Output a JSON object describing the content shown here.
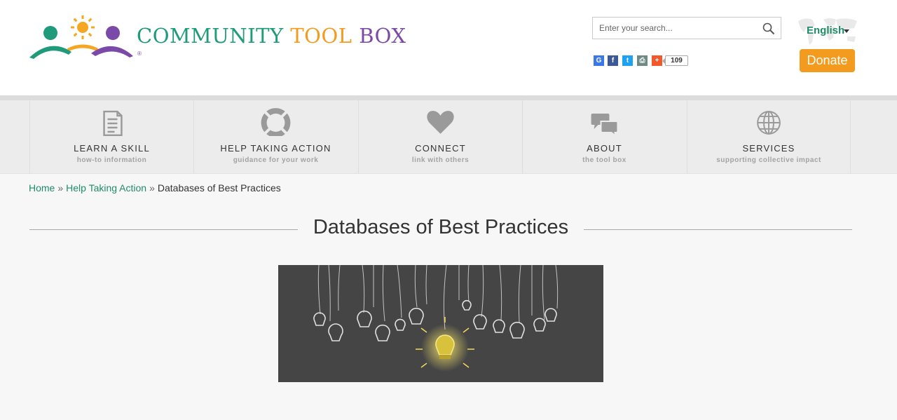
{
  "brand": {
    "word1": "COMMUNITY",
    "word2": "TOOL",
    "word3": "BOX",
    "registered": "®",
    "colors": {
      "teal": "#1f9a7a",
      "orange": "#f39b1e",
      "purple": "#7b4aa8",
      "sun": "#f5a623"
    }
  },
  "search": {
    "placeholder": "Enter your search..."
  },
  "language": {
    "label": "English"
  },
  "donate": {
    "label": "Donate",
    "color": "#f39b1e"
  },
  "share": {
    "buttons": [
      {
        "name": "google",
        "glyph": "G",
        "color": "#3b78e7"
      },
      {
        "name": "facebook",
        "glyph": "f",
        "color": "#3b5998"
      },
      {
        "name": "twitter",
        "glyph": "t",
        "color": "#1da1f2"
      },
      {
        "name": "print",
        "glyph": "⎙",
        "color": "#6d8a85"
      },
      {
        "name": "more",
        "glyph": "+",
        "color": "#f1582c"
      }
    ],
    "count": "109"
  },
  "nav": [
    {
      "title": "LEARN A SKILL",
      "subtitle": "how-to information",
      "icon": "document-icon"
    },
    {
      "title": "HELP TAKING ACTION",
      "subtitle": "guidance for your work",
      "icon": "lifebuoy-icon"
    },
    {
      "title": "CONNECT",
      "subtitle": "link with others",
      "icon": "heart-icon"
    },
    {
      "title": "ABOUT",
      "subtitle": "the tool box",
      "icon": "chat-icon"
    },
    {
      "title": "SERVICES",
      "subtitle": "supporting collective impact",
      "icon": "globe-icon"
    }
  ],
  "breadcrumb": {
    "home": "Home",
    "separator": "»",
    "section": "Help Taking Action",
    "current": "Databases of Best Practices"
  },
  "page": {
    "title": "Databases of Best Practices"
  },
  "hero": {
    "icon": "lightbulbs-illustration"
  }
}
